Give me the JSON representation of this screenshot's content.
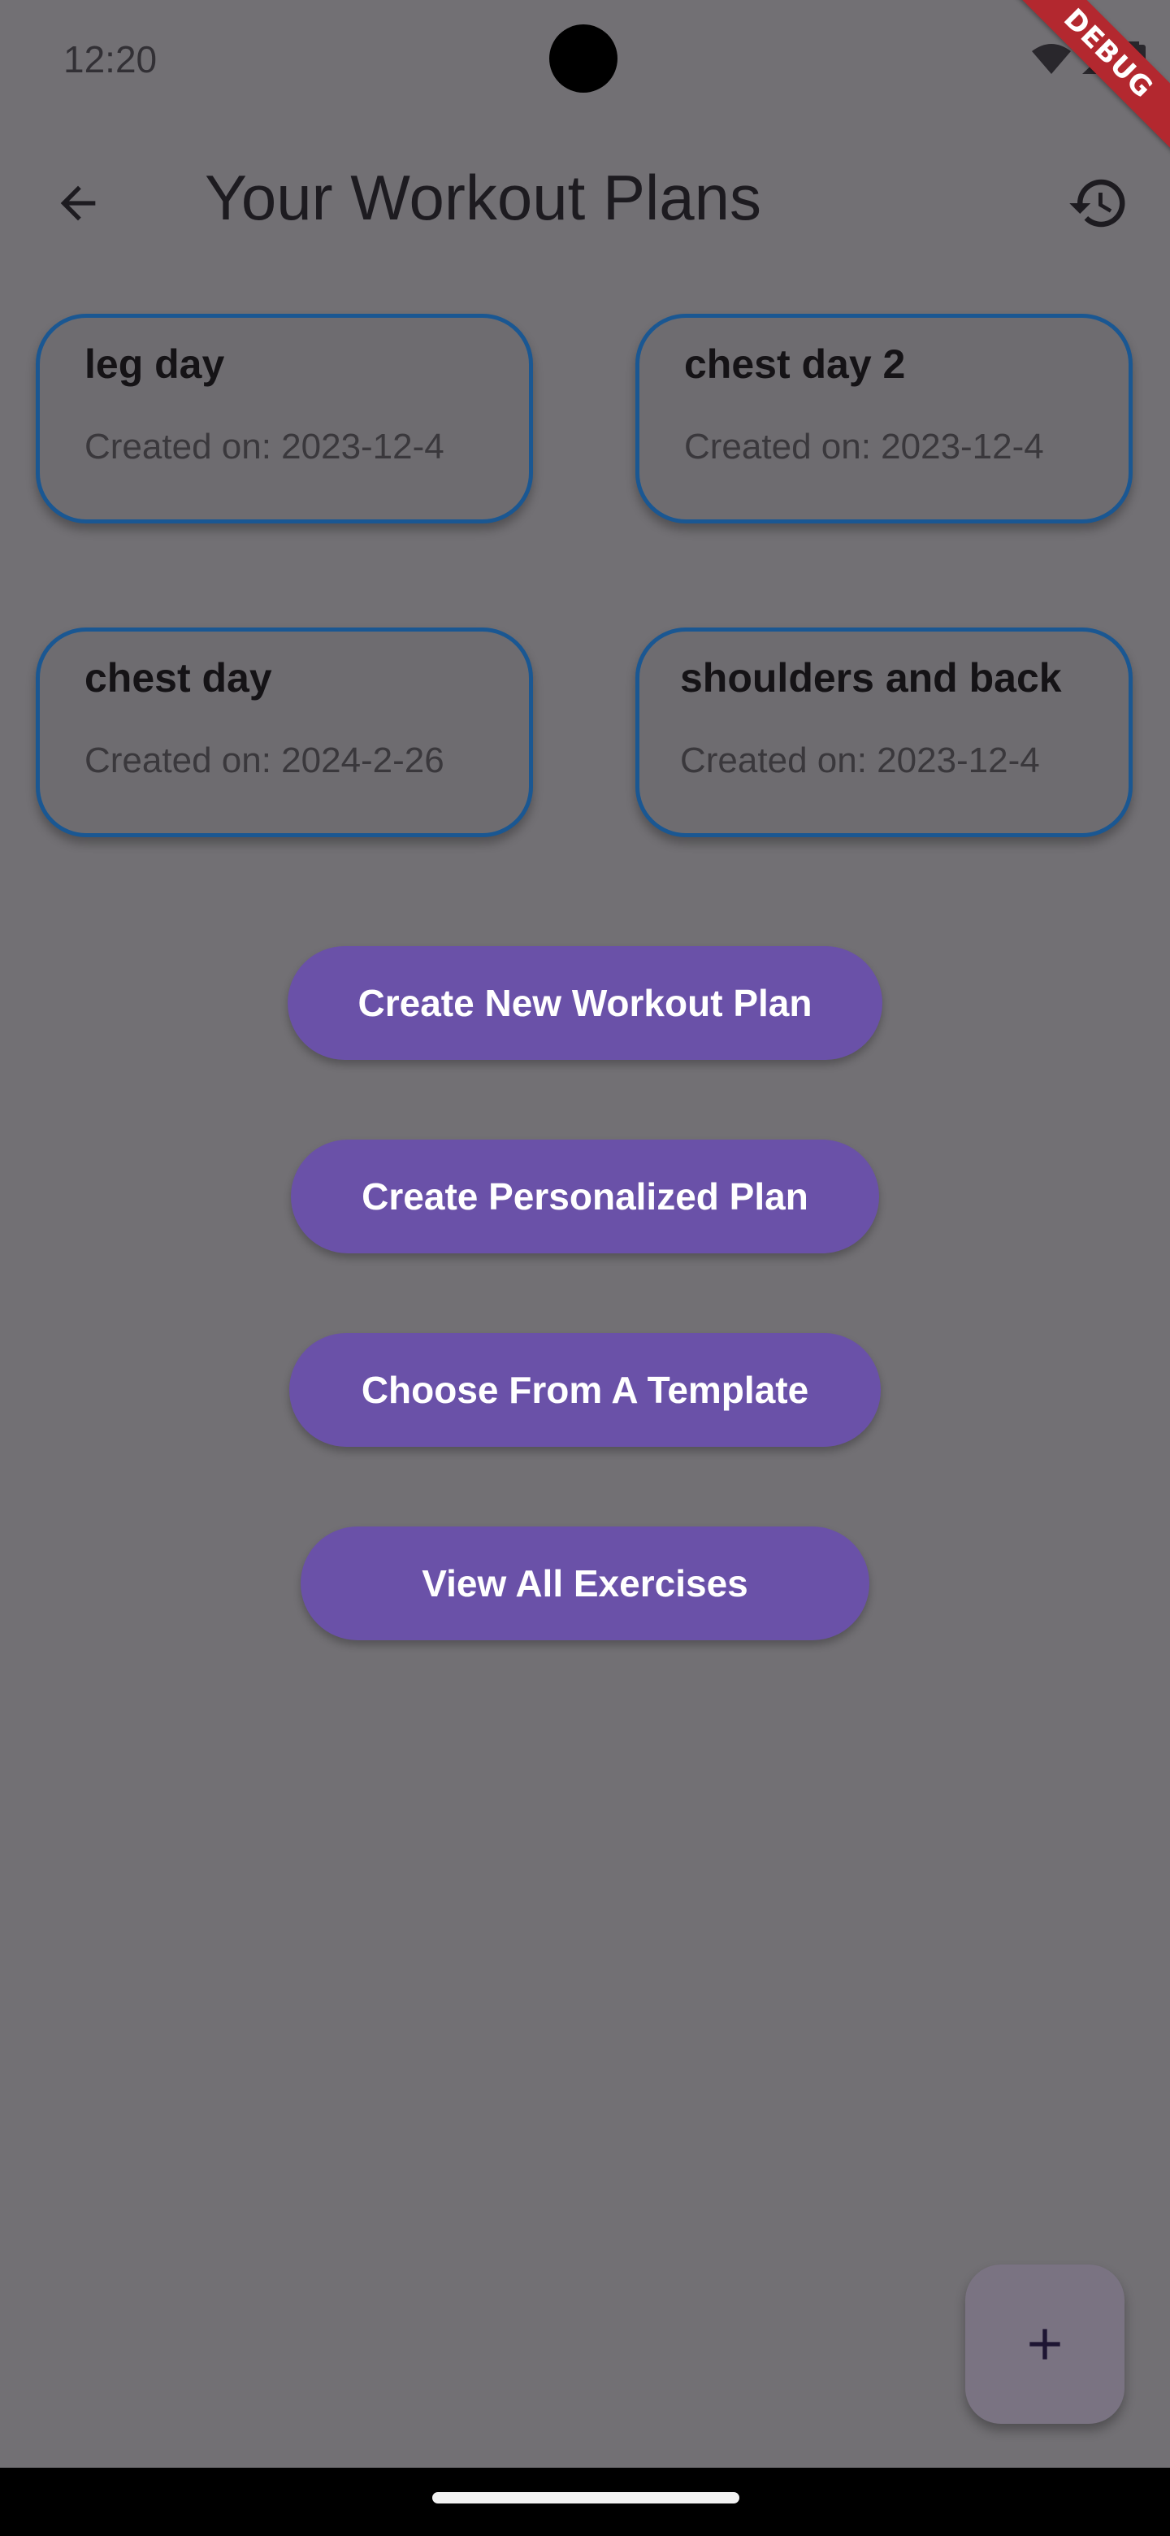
{
  "status_bar": {
    "time": "12:20",
    "icons": [
      "wifi-icon",
      "signal-icon",
      "battery-icon"
    ]
  },
  "debug_banner": "DEBUG",
  "app_bar": {
    "title": "Your Workout Plans",
    "back_icon": "arrow-back-icon",
    "history_icon": "history-icon"
  },
  "plans": [
    {
      "name": "leg day",
      "created": "Created on: 2023-12-4"
    },
    {
      "name": "chest day 2",
      "created": "Created on: 2023-12-4"
    },
    {
      "name": "chest day",
      "created": "Created on: 2024-2-26"
    },
    {
      "name": "shoulders and back",
      "created": "Created on: 2023-12-4"
    }
  ],
  "actions": {
    "create_new": "Create New Workout Plan",
    "create_personalized": "Create Personalized Plan",
    "choose_template": "Choose From A Template",
    "view_exercises": "View All Exercises"
  },
  "fab": {
    "icon": "plus-icon"
  },
  "colors": {
    "scrim_background": "#727074",
    "card_border": "#1a5792",
    "button_fill": "#6a51a8",
    "debug_ribbon": "#b3282f"
  }
}
